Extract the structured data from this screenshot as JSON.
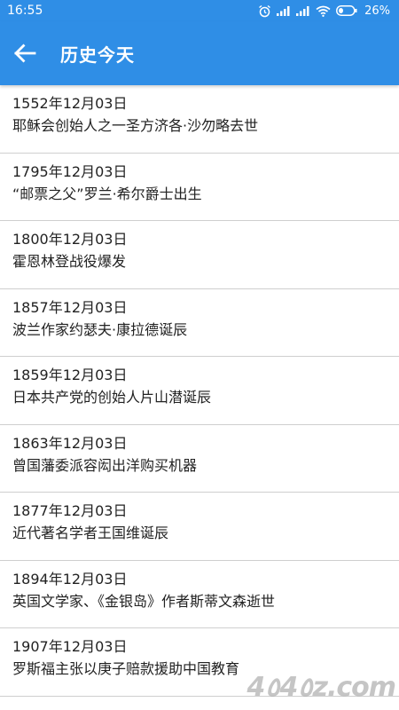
{
  "status_bar": {
    "time": "16:55",
    "battery": "26%",
    "icons": [
      "alarm-icon",
      "signal-icon",
      "signal-icon",
      "wifi-icon",
      "battery-icon"
    ]
  },
  "app_bar": {
    "title": "历史今天",
    "back_icon": "arrow-left-icon"
  },
  "events": [
    {
      "date": "1552年12月03日",
      "title": "耶稣会创始人之一圣方济各·沙勿略去世"
    },
    {
      "date": "1795年12月03日",
      "title": "“邮票之父”罗兰·希尔爵士出生"
    },
    {
      "date": "1800年12月03日",
      "title": "霍恩林登战役爆发"
    },
    {
      "date": "1857年12月03日",
      "title": "波兰作家约瑟夫·康拉德诞辰"
    },
    {
      "date": "1859年12月03日",
      "title": "日本共产党的创始人片山潜诞辰"
    },
    {
      "date": "1863年12月03日",
      "title": "曾国藩委派容闳出洋购买机器"
    },
    {
      "date": "1877年12月03日",
      "title": "近代著名学者王国维诞辰"
    },
    {
      "date": "1894年12月03日",
      "title": "英国文学家、《金银岛》作者斯蒂文森逝世"
    },
    {
      "date": "1907年12月03日",
      "title": "罗斯福主张以庚子赔款援助中国教育"
    }
  ],
  "watermark": "4٥4٥z.com",
  "colors": {
    "primary": "#2f8ee6",
    "divider": "#cfcfcf",
    "text": "#222222"
  }
}
